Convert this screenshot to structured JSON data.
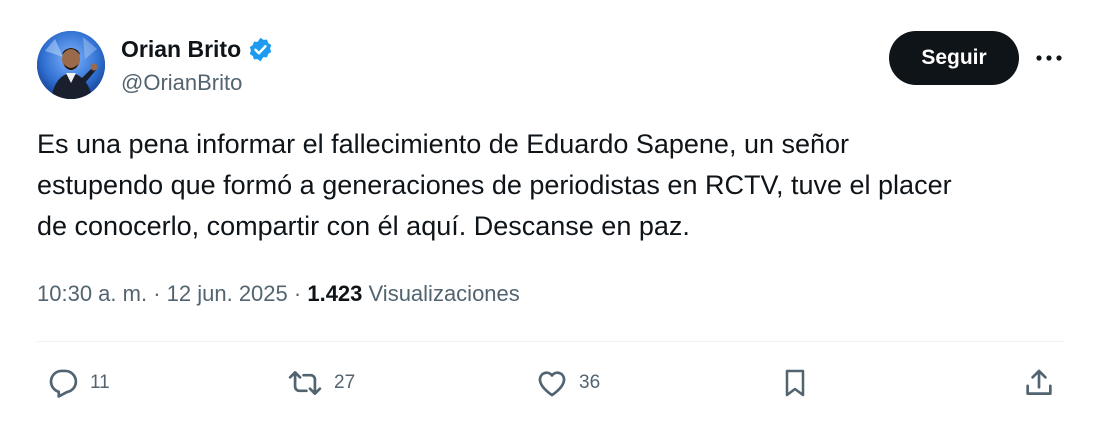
{
  "author": {
    "display_name": "Orian Brito",
    "handle": "@OrianBrito",
    "verified": true
  },
  "header": {
    "follow_label": "Seguir"
  },
  "tweet": {
    "text_lines": [
      "Es una pena informar el fallecimiento de Eduardo Sapene, un señor",
      "estupendo que formó a generaciones de periodistas en RCTV, tuve el placer",
      "de conocerlo, compartir con él aquí. Descanse en paz."
    ]
  },
  "meta": {
    "time": "10:30 a. m.",
    "separator": "·",
    "date": "12 jun. 2025",
    "views_count": "1.423",
    "views_label": "Visualizaciones"
  },
  "actions": {
    "replies": "11",
    "reposts": "27",
    "likes": "36"
  },
  "colors": {
    "text_primary": "#0f1419",
    "text_secondary": "#536471",
    "verified_blue": "#1d9bf0",
    "divider": "#eff3f4"
  },
  "icons": {
    "reply": "speech-bubble-icon",
    "repost": "repost-arrows-icon",
    "like": "heart-icon",
    "bookmark": "bookmark-icon",
    "share": "share-upload-icon",
    "more": "three-dots-icon",
    "verified": "verified-badge-icon"
  }
}
